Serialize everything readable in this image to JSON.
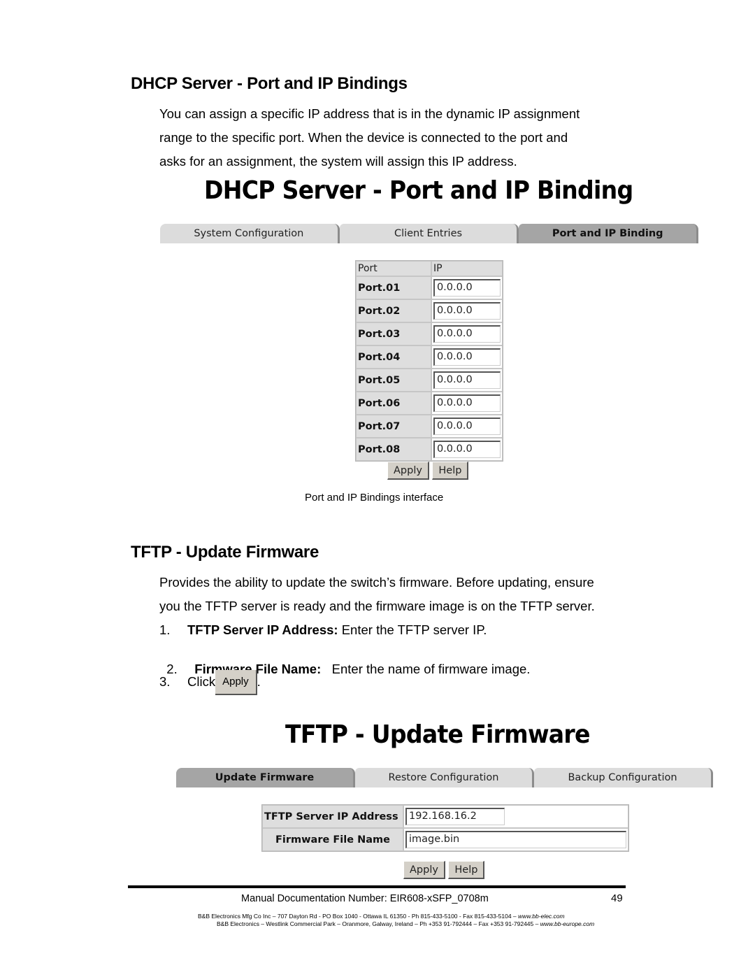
{
  "section1": {
    "heading": "DHCP Server - Port and IP Bindings",
    "paragraph_lines": [
      "You can assign a specific IP address that is in the dynamic IP assignment",
      "range to the specific port. When the device is connected to the port and",
      "asks for an assignment, the system will assign this IP address."
    ],
    "screenshot": {
      "title": "DHCP Server - Port and IP Binding",
      "tabs": [
        {
          "label": "System Configuration",
          "active": false
        },
        {
          "label": "Client Entries",
          "active": false
        },
        {
          "label": "Port and IP Binding",
          "active": true
        }
      ],
      "table": {
        "headers": [
          "Port",
          "IP"
        ],
        "rows": [
          {
            "port": "Port.01",
            "ip": "0.0.0.0"
          },
          {
            "port": "Port.02",
            "ip": "0.0.0.0"
          },
          {
            "port": "Port.03",
            "ip": "0.0.0.0"
          },
          {
            "port": "Port.04",
            "ip": "0.0.0.0"
          },
          {
            "port": "Port.05",
            "ip": "0.0.0.0"
          },
          {
            "port": "Port.06",
            "ip": "0.0.0.0"
          },
          {
            "port": "Port.07",
            "ip": "0.0.0.0"
          },
          {
            "port": "Port.08",
            "ip": "0.0.0.0"
          }
        ]
      },
      "apply_label": "Apply",
      "help_label": "Help"
    },
    "caption": "Port and IP Bindings interface"
  },
  "section2": {
    "heading": "TFTP - Update Firmware",
    "paragraph_lines": [
      "Provides the ability to update the switch’s firmware. Before updating, ensure",
      "you the TFTP server is ready and the firmware image is on the TFTP server."
    ],
    "steps": [
      {
        "num": "1.",
        "bold": "TFTP Server IP Address:",
        "text": " Enter the TFTP server IP."
      },
      {
        "num": "2.",
        "bold": "Firmware File Name:",
        "text": "   Enter the name of firmware image."
      },
      {
        "num": "3.",
        "bold": "",
        "text": "Click",
        "button": "Apply",
        "after": "."
      }
    ],
    "screenshot": {
      "title": "TFTP - Update Firmware",
      "tabs": [
        {
          "label": "Update Firmware",
          "active": true
        },
        {
          "label": "Restore Configuration",
          "active": false
        },
        {
          "label": "Backup Configuration",
          "active": false
        }
      ],
      "fields": [
        {
          "label": "TFTP Server IP Address",
          "value": "192.168.16.2"
        },
        {
          "label": "Firmware File Name",
          "value": "image.bin"
        }
      ],
      "apply_label": "Apply",
      "help_label": "Help"
    }
  },
  "footer": {
    "doc_number": "Manual Documentation Number: EIR608-xSFP_0708m",
    "page_number": "49",
    "line1": "B&B Electronics Mfg Co Inc – 707 Dayton Rd - PO Box 1040 - Ottawa IL 61350 - Ph 815-433-5100 - Fax 815-433-5104 – ",
    "line1_url": "www.bb-elec.com",
    "line2": "B&B Electronics – Westlink Commercial Park – Oranmore, Galway, Ireland – Ph +353 91-792444 – Fax +353 91-792445 – ",
    "line2_url": "www.bb-europe.com"
  }
}
